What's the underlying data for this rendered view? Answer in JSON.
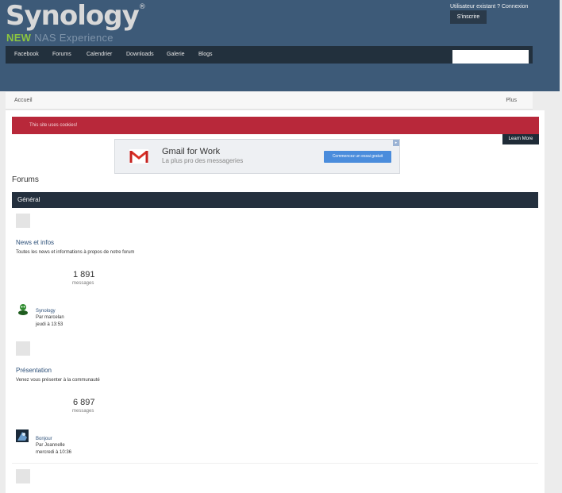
{
  "header": {
    "logo_text": "Synology",
    "logo_reg": "®",
    "tagline_new": "NEW",
    "tagline_rest": "NAS Experience",
    "signin_text": "Utilisateur existant ? Connexion",
    "signup_label": "S'inscrire"
  },
  "nav": {
    "items": [
      "Facebook",
      "Forums",
      "Calendrier",
      "Downloads",
      "Galerie",
      "Blogs"
    ]
  },
  "breadcrumb": {
    "home": "Accueil",
    "more": "Plus"
  },
  "cookie": {
    "text": "This site uses cookies!",
    "learn_more": "Learn More"
  },
  "ad": {
    "title": "Gmail for Work",
    "subtitle": "La plus pro des messageries",
    "cta": "Commencez un essai gratuit"
  },
  "page": {
    "title": "Forums"
  },
  "category": {
    "title": "Général"
  },
  "forums": [
    {
      "name": "News et infos",
      "description": "Toutes les news et informations à propos de notre forum",
      "count": "1 891",
      "count_label": "messages",
      "last_user": "Synology",
      "last_by": "Par marcelan",
      "last_date": "jeudi à 13:53"
    },
    {
      "name": "Présentation",
      "description": "Venez vous présenter à la communauté",
      "count": "6 897",
      "count_label": "messages",
      "last_user": "Bonjour",
      "last_by": "Par Joannelle",
      "last_date": "mercredi à 10:36"
    }
  ],
  "colors": {
    "header_bg": "#3d5a78",
    "nav_bg": "#22303d",
    "cookie_bg": "#b8283a",
    "category_bg": "#24303e",
    "accent_green": "#8cc63f",
    "link": "#2d5079"
  }
}
